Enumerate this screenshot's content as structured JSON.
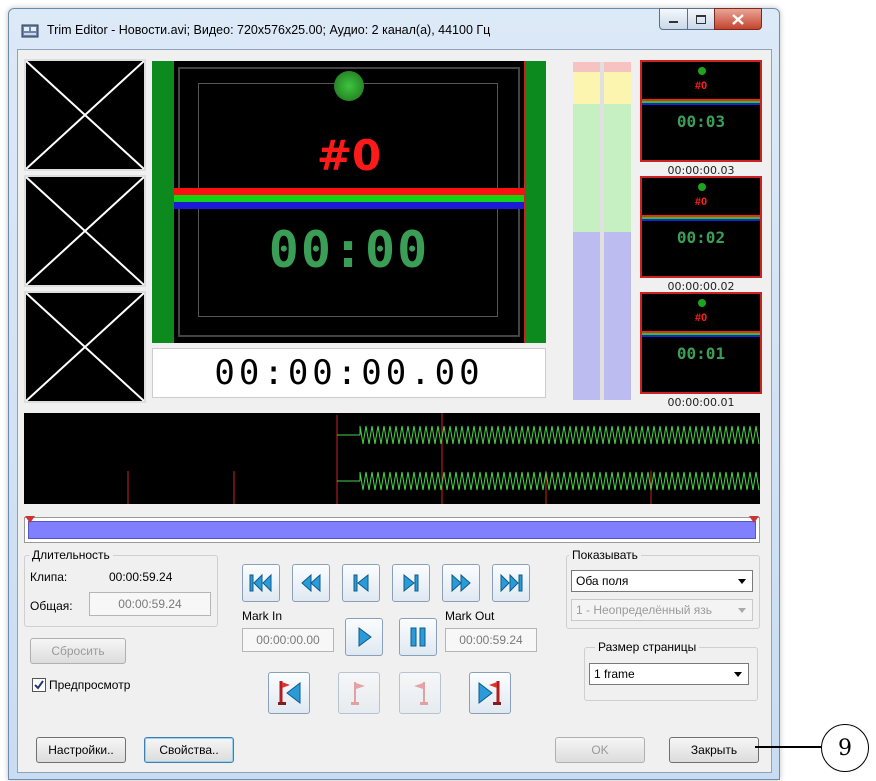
{
  "window": {
    "title": "Trim Editor - Новости.avi; Видео: 720x576x25.00; Аудио: 2 канал(а), 44100 Гц"
  },
  "preview": {
    "clip_number": "#0",
    "clip_time": "00:00",
    "timecode": "00:00:00.00"
  },
  "frames": [
    {
      "number": "#0",
      "time": "00:03",
      "timecode": "00:00:00.03"
    },
    {
      "number": "#0",
      "time": "00:02",
      "timecode": "00:00:00.02"
    },
    {
      "number": "#0",
      "time": "00:01",
      "timecode": "00:00:00.01"
    }
  ],
  "duration": {
    "group_label": "Длительность",
    "clip_label": "Клипа:",
    "clip_value": "00:00:59.24",
    "total_label": "Общая:",
    "total_value": "00:00:59.24"
  },
  "buttons": {
    "reset": "Сбросить",
    "settings": "Настройки..",
    "properties": "Свойства..",
    "ok": "OK",
    "close": "Закрыть"
  },
  "preview_checkbox": {
    "label": "Предпросмотр",
    "checked": true
  },
  "mark_in": {
    "label": "Mark In",
    "value": "00:00:00.00"
  },
  "mark_out": {
    "label": "Mark Out",
    "value": "00:00:59.24"
  },
  "show": {
    "group_label": "Показывать",
    "fields_value": "Оба поля",
    "language_value": "1 - Неопределённый язь"
  },
  "page_size": {
    "group_label": "Размер страницы",
    "value": "1 frame"
  },
  "callout": {
    "number": "9"
  },
  "icons": [
    "app-icon",
    "minimize-icon",
    "maximize-icon",
    "close-icon",
    "go-start-icon",
    "rewind-icon",
    "step-back-icon",
    "step-forward-icon",
    "fast-forward-icon",
    "go-end-icon",
    "play-icon",
    "pause-icon",
    "set-mark-in-icon",
    "flag-in-icon",
    "flag-out-icon",
    "set-mark-out-icon"
  ],
  "colors": {
    "accent": "#2a9bd8",
    "timeline": "#8080ff",
    "waveform": "#49d14a",
    "marker": "#cc2222"
  }
}
